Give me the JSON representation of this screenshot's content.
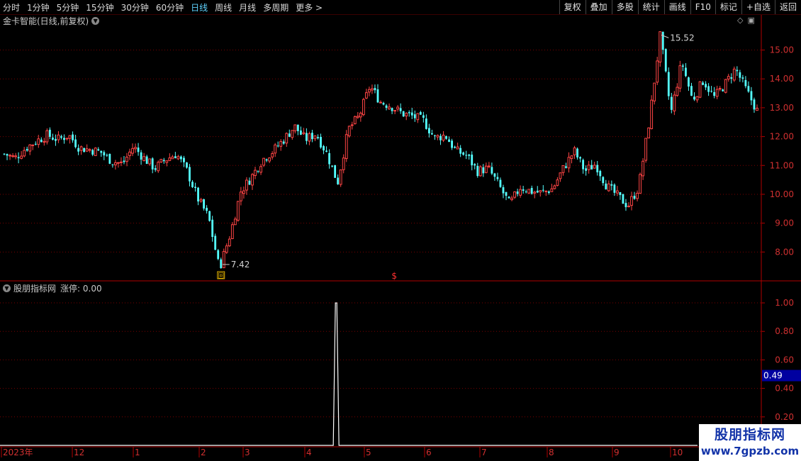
{
  "toolbar": {
    "periods": [
      {
        "label": "分时",
        "active": false
      },
      {
        "label": "1分钟",
        "active": false
      },
      {
        "label": "5分钟",
        "active": false
      },
      {
        "label": "15分钟",
        "active": false
      },
      {
        "label": "30分钟",
        "active": false
      },
      {
        "label": "60分钟",
        "active": false
      },
      {
        "label": "日线",
        "active": true
      },
      {
        "label": "周线",
        "active": false
      },
      {
        "label": "月线",
        "active": false
      },
      {
        "label": "多周期",
        "active": false
      },
      {
        "label": "更多 >",
        "active": false
      }
    ],
    "tools": [
      "复权",
      "叠加",
      "多股",
      "统计",
      "画线",
      "F10",
      "标记",
      "+自选",
      "返回"
    ]
  },
  "main_chart": {
    "title": "金卡智能(日线,前复权)",
    "high_label": "15.52",
    "low_label": "7.42",
    "marker_symbol": "$",
    "low_marker_symbol": "回"
  },
  "indicator": {
    "name": "股朋指标网",
    "value_text": "涨停: 0.00",
    "current_value_badge": "0.49"
  },
  "x_axis": {
    "labels": [
      "2023年",
      "12",
      "1",
      "2",
      "3",
      "4",
      "5",
      "6",
      "7",
      "8",
      "9",
      "10"
    ]
  },
  "watermark": {
    "line1": "股朋指标网",
    "line2": "www.7gpzb.com"
  },
  "colors": {
    "up": "#ff4545",
    "down": "#54ffff",
    "grid": "#7a0000",
    "axis": "#b00000",
    "axis_text": "#d03030",
    "text": "#c8c8c8",
    "active_period": "#5fd3ff",
    "indicator_line": "#ffffff",
    "badge_bg": "#0000a0"
  },
  "chart_data": [
    {
      "type": "candlestick",
      "title": "金卡智能(日线,前复权)",
      "y_ticks": [
        8.0,
        9.0,
        10.0,
        11.0,
        12.0,
        13.0,
        14.0,
        15.0
      ],
      "ylim": [
        7.0,
        15.8
      ],
      "x_labels": [
        "2023年",
        "12",
        "1",
        "2",
        "3",
        "4",
        "5",
        "6",
        "7",
        "8",
        "9",
        "10"
      ],
      "annotations": [
        {
          "label": "15.52",
          "type": "max"
        },
        {
          "label": "7.42",
          "type": "min"
        }
      ],
      "close_path": [
        11.4,
        11.25,
        11.6,
        11.85,
        12.05,
        11.9,
        12.05,
        11.6,
        11.55,
        11.45,
        11.15,
        11.05,
        11.65,
        11.25,
        10.9,
        11.2,
        11.4,
        10.8,
        9.85,
        9.2,
        7.42,
        8.6,
        10.1,
        10.6,
        11.2,
        11.5,
        11.9,
        12.35,
        11.9,
        12.1,
        11.4,
        10.4,
        12.25,
        12.7,
        13.75,
        13.2,
        13.05,
        12.8,
        12.7,
        12.55,
        11.95,
        12.05,
        11.5,
        11.35,
        10.8,
        10.9,
        10.3,
        9.65,
        10.25,
        10.1,
        10.05,
        10.2,
        10.9,
        11.5,
        10.8,
        11.05,
        10.3,
        9.95,
        9.6,
        10.25,
        12.6,
        15.52,
        12.8,
        14.6,
        13.25,
        13.95,
        13.35,
        13.8,
        14.35,
        13.6,
        12.9
      ]
    },
    {
      "type": "line",
      "name": "涨停",
      "y_ticks": [
        0.2,
        0.4,
        0.6,
        0.8,
        1.0
      ],
      "ylim": [
        0,
        1.05
      ],
      "current_value": 0.49,
      "spike": {
        "position_fraction": 0.4415,
        "value": 1.0
      },
      "baseline": 0.0
    }
  ]
}
